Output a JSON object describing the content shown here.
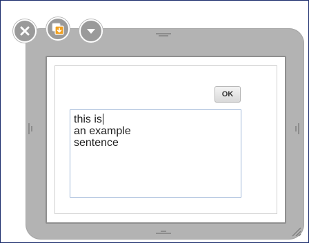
{
  "window": {
    "controls": {
      "close_icon": "close-x-icon",
      "settings_icon": "orange-widget-settings-icon",
      "collapse_icon": "chevron-down-icon"
    },
    "accent_color": "#f0a020",
    "bezel_color": "#b3b3b3",
    "border_color": "#1a2b6b"
  },
  "dialog": {
    "ok_label": "OK",
    "text_lines": [
      "this is",
      "an example",
      "sentence"
    ],
    "caret_after_line": 0
  }
}
